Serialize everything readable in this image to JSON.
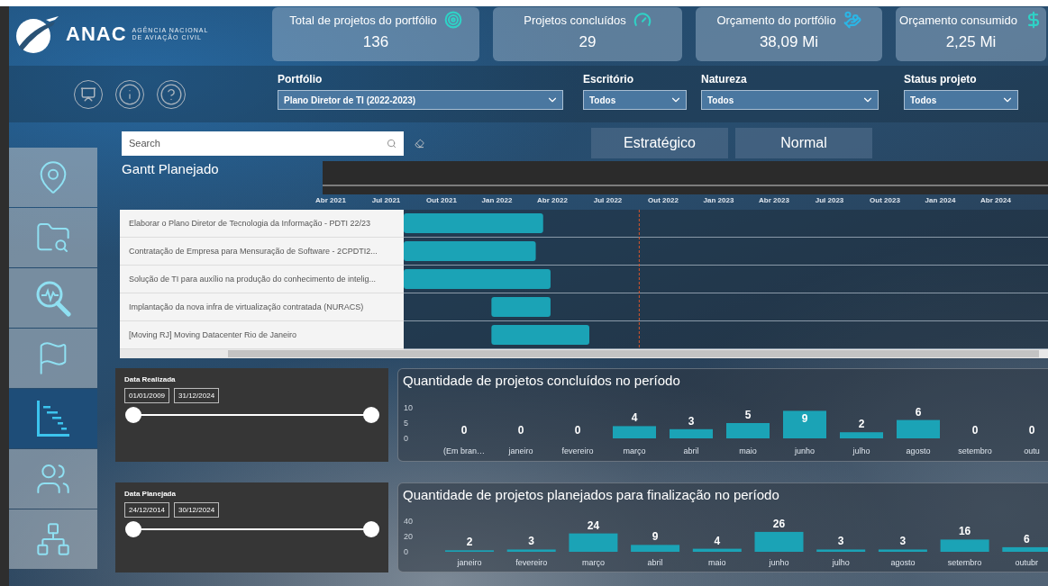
{
  "logo": {
    "name": "ANAC",
    "subtitle_1": "AGÊNCIA NACIONAL",
    "subtitle_2": "DE AVIAÇÃO CIVIL"
  },
  "kpis": [
    {
      "kind": "target",
      "label": "Total de projetos do portfólio",
      "value": "136"
    },
    {
      "kind": "gauge",
      "label": "Projetos concluídos",
      "value": "29"
    },
    {
      "kind": "money",
      "label": "Orçamento do portfólio",
      "value": "38,09 Mi"
    },
    {
      "kind": "dollar",
      "label": "Orçamento consumido",
      "value": "2,25 Mi"
    }
  ],
  "toolbar_icons": [
    {
      "kind": "presentation"
    },
    {
      "kind": "info"
    },
    {
      "kind": "help"
    }
  ],
  "filters": [
    {
      "label": "Portfólio",
      "value": "Plano Diretor de TI (2022-2023)"
    },
    {
      "label": "Escritório",
      "value": "Todos"
    },
    {
      "label": "Natureza",
      "value": "Todos"
    },
    {
      "label": "Status projeto",
      "value": "Todos"
    }
  ],
  "sidebar": {
    "items": [
      {
        "kind": "home",
        "selected": false
      },
      {
        "kind": "folder-search",
        "selected": false
      },
      {
        "kind": "monitor",
        "selected": false
      },
      {
        "kind": "flag",
        "selected": false
      },
      {
        "kind": "gantt",
        "selected": true
      },
      {
        "kind": "team",
        "selected": false
      },
      {
        "kind": "hierarchy",
        "selected": false
      }
    ]
  },
  "search": {
    "placeholder": "Search"
  },
  "tabs": [
    {
      "label": "Estratégico",
      "selected": false
    },
    {
      "label": "Normal",
      "selected": false
    }
  ],
  "gantt": {
    "title": "Gantt Planejado",
    "timeline": [
      "Abr 2021",
      "Jul 2021",
      "Out 2021",
      "Jan 2022",
      "Abr 2022",
      "Jul 2022",
      "Out 2022",
      "Jan 2023",
      "Abr 2023",
      "Jul 2023",
      "Out 2023",
      "Jan 2024",
      "Abr 2024"
    ],
    "tasks": [
      {
        "name": "Elaborar o Plano Diretor de Tecnologia da Informação - PDTI 22/23"
      },
      {
        "name": "Contratação de Empresa para Mensuração de Software - 2CPDTI2..."
      },
      {
        "name": "Solução de TI para auxílio na produção do conhecimento de intelig..."
      },
      {
        "name": "Implantação da nova infra de virtualização contratada (NURACS)"
      },
      {
        "name": "[Moving RJ] Moving Datacenter Rio de Janeiro"
      }
    ]
  },
  "panels": [
    {
      "slider": {
        "label": "Data Realizada",
        "start": "01/01/2009",
        "end": "31/12/2024",
        "level": 1
      },
      "chart_data": {
        "type": "bar",
        "title": "Quantidade de projetos concluídos no período",
        "categories": [
          "(Em bran…",
          "janeiro",
          "fevereiro",
          "março",
          "abril",
          "maio",
          "junho",
          "julho",
          "agosto",
          "setembro",
          "outu"
        ],
        "values": [
          0,
          0,
          0,
          4,
          3,
          5,
          9,
          2,
          6,
          0,
          0
        ],
        "color": "#1ba3b6",
        "ylim": [
          0,
          10
        ],
        "yticks": [
          0,
          5,
          10
        ],
        "data_labels": true
      }
    },
    {
      "slider": {
        "label": "Data Planejada",
        "start": "24/12/2014",
        "end": "30/12/2024",
        "level": 1
      },
      "chart_data": {
        "type": "bar",
        "title": "Quantidade de projetos planejados para finalização no período",
        "categories": [
          "janeiro",
          "fevereiro",
          "março",
          "abril",
          "maio",
          "junho",
          "julho",
          "agosto",
          "setembro",
          "outubr"
        ],
        "values": [
          2,
          3,
          24,
          9,
          4,
          26,
          3,
          3,
          16,
          6
        ],
        "color": "#1ba3b6",
        "ylim": [
          0,
          40
        ],
        "yticks": [
          0,
          20,
          40
        ],
        "data_labels": true
      }
    }
  ]
}
